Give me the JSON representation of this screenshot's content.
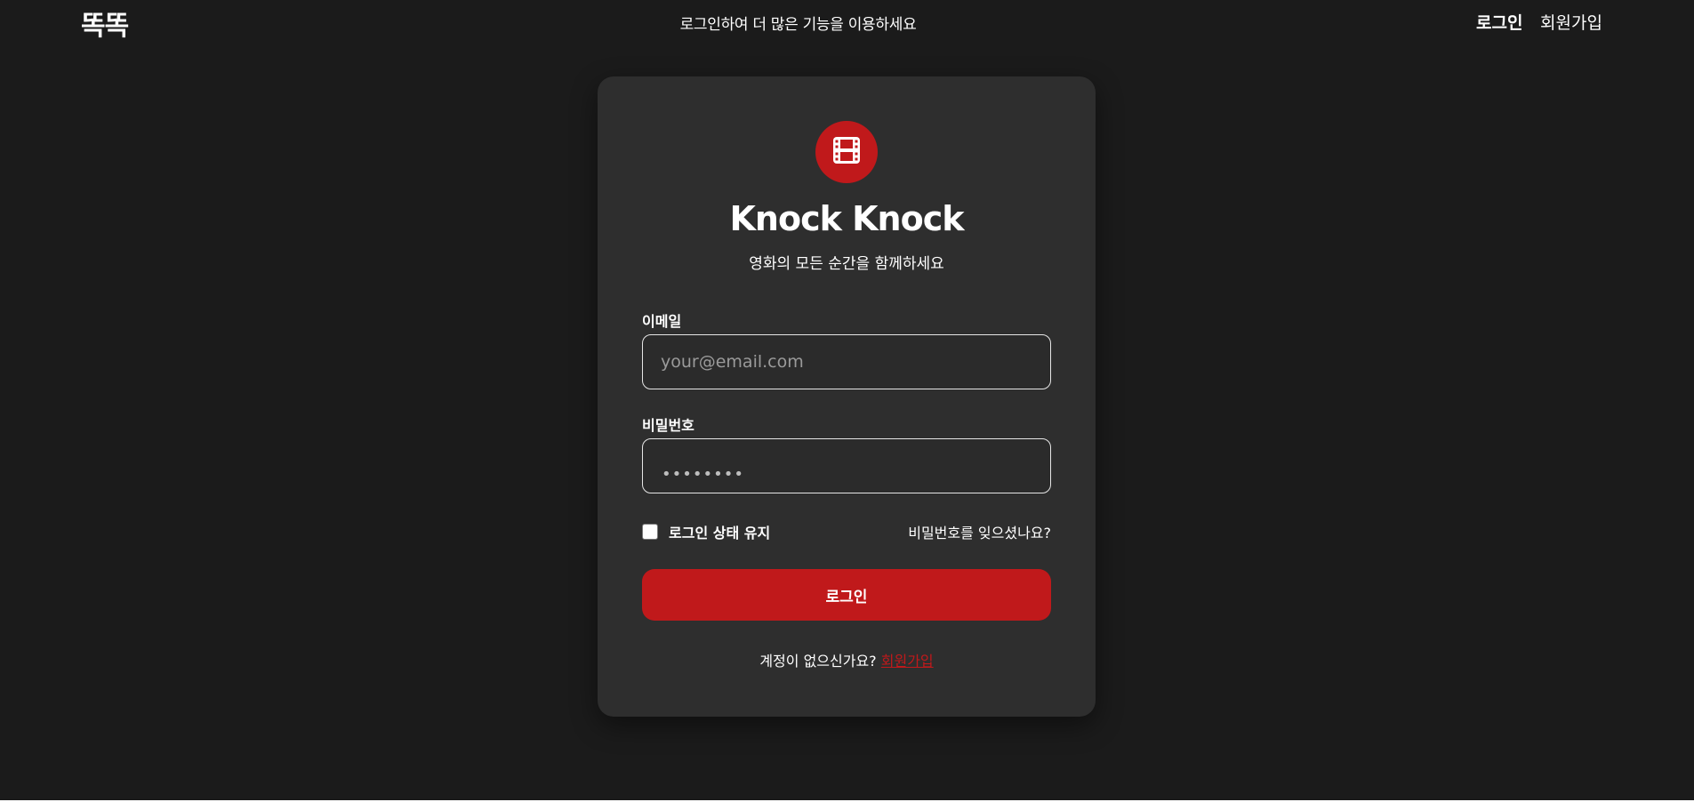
{
  "header": {
    "logo": "똑똑",
    "message": "로그인하여 더 많은 기능을 이용하세요",
    "nav_login": "로그인",
    "nav_signup": "회원가입"
  },
  "card": {
    "brand_icon": "film-icon",
    "brand_title": "Knock Knock",
    "brand_subtitle": "영화의 모든 순간을 함께하세요",
    "email": {
      "label": "이메일",
      "placeholder": "your@email.com",
      "value": ""
    },
    "password": {
      "label": "비밀번호",
      "masked_value": "••••••••"
    },
    "remember_label": "로그인 상태 유지",
    "remember_checked": false,
    "forgot_label": "비밀번호를 잊으셨나요?",
    "login_button": "로그인",
    "no_account_text": "계정이 없으신가요?",
    "signup_link": "회원가입"
  },
  "colors": {
    "background": "#1b1b1b",
    "card": "#2e2e2e",
    "accent": "#c0191b",
    "text": "#ffffff"
  }
}
